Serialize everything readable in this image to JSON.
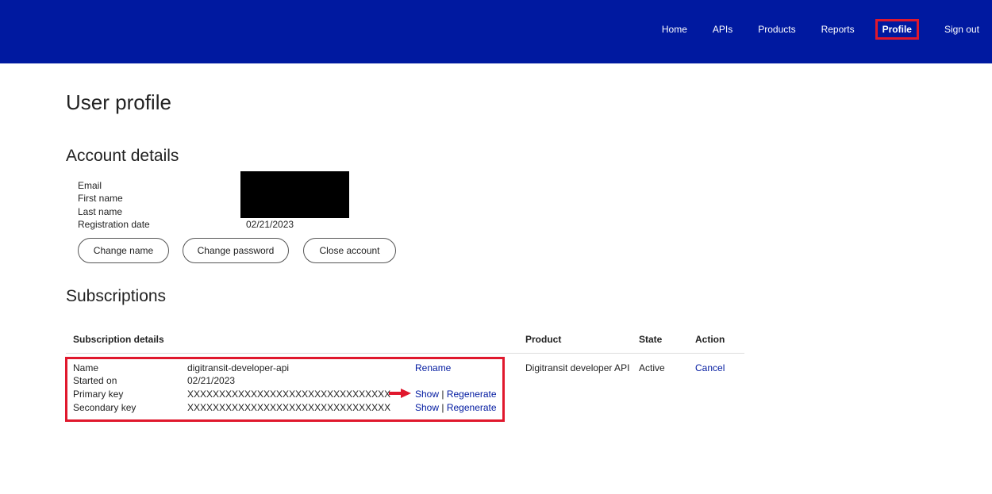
{
  "nav": {
    "items": [
      "Home",
      "APIs",
      "Products",
      "Reports",
      "Profile",
      "Sign out"
    ],
    "active": "Profile"
  },
  "page_title": "User profile",
  "account": {
    "heading": "Account details",
    "labels": {
      "email": "Email",
      "first_name": "First name",
      "last_name": "Last name",
      "registration_date": "Registration date"
    },
    "registration_date_value": "02/21/2023",
    "buttons": {
      "change_name": "Change name",
      "change_password": "Change password",
      "close_account": "Close account"
    }
  },
  "subscriptions": {
    "heading": "Subscriptions",
    "columns": {
      "details": "Subscription details",
      "product": "Product",
      "state": "State",
      "action": "Action"
    },
    "row": {
      "name_label": "Name",
      "name_value": "digitransit-developer-api",
      "started_label": "Started on",
      "started_value": "02/21/2023",
      "primary_label": "Primary key",
      "primary_value": "XXXXXXXXXXXXXXXXXXXXXXXXXXXXXXXX",
      "secondary_label": "Secondary key",
      "secondary_value": "XXXXXXXXXXXXXXXXXXXXXXXXXXXXXXXX",
      "rename": "Rename",
      "show": "Show",
      "separator": "|",
      "regenerate": "Regenerate",
      "product": "Digitransit developer API",
      "state": "Active",
      "cancel": "Cancel"
    }
  },
  "colors": {
    "header_bg": "#0019a0",
    "highlight": "#e0182d",
    "link": "#0019a0"
  }
}
